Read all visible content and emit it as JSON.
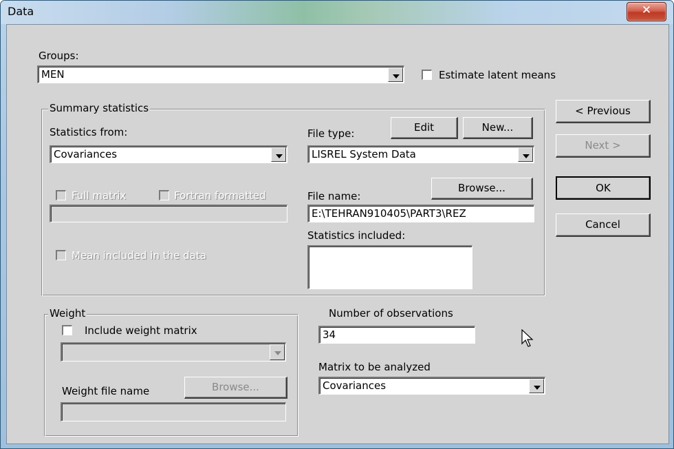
{
  "window": {
    "title": "Data",
    "close_glyph": "✕"
  },
  "groups": {
    "label": "Groups:",
    "value": "MEN",
    "estimate_latent_means": "Estimate latent means"
  },
  "summary": {
    "legend": "Summary statistics",
    "statistics_from_label": "Statistics from:",
    "statistics_from_value": "Covariances",
    "file_type_label": "File type:",
    "edit_label": "Edit",
    "new_label": "New...",
    "file_type_value": "LISREL System Data",
    "full_matrix": "Full matrix",
    "fortran_formatted": "Fortran formatted",
    "file_name_label": "File name:",
    "browse_label": "Browse...",
    "file_name_value": "E:\\TEHRAN910405\\PART3\\REZ",
    "statistics_included_label": "Statistics included:",
    "mean_included": "Mean included in the data"
  },
  "nav": {
    "previous": "< Previous",
    "next": "Next >",
    "ok": "OK",
    "cancel": "Cancel"
  },
  "weight": {
    "legend": "Weight",
    "include_label": "Include weight matrix",
    "file_name_label": "Weight file name",
    "browse_label": "Browse..."
  },
  "observations": {
    "label": "Number of observations",
    "value": "34"
  },
  "matrix": {
    "label": "Matrix to be analyzed",
    "value": "Covariances"
  },
  "icons": {
    "cursor": "arrow-pointer-icon",
    "close": "close-icon",
    "dropdown": "chevron-down-icon"
  }
}
